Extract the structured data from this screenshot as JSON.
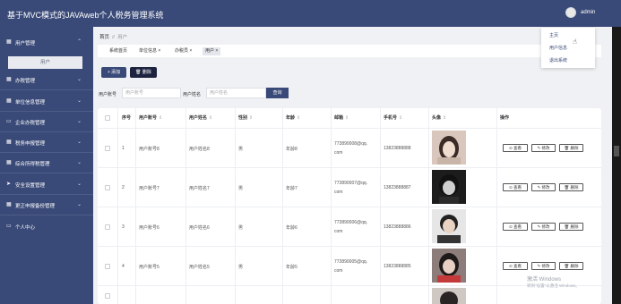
{
  "header": {
    "title": "基于MVC模式的JAVAweb个人税务管理系统",
    "user": "admin"
  },
  "user_menu": {
    "items": [
      "主页",
      "用户信息",
      "退出系统"
    ]
  },
  "sidebar": {
    "items": [
      {
        "label": "用户管理",
        "icon": "grid-icon",
        "expanded": true
      },
      {
        "label": "办税管理",
        "icon": "grid-icon"
      },
      {
        "label": "单位信息管理",
        "icon": "grid-icon"
      },
      {
        "label": "企业办税管理",
        "icon": "card-icon"
      },
      {
        "label": "税务申报管理",
        "icon": "grid-icon"
      },
      {
        "label": "综合所得税管理",
        "icon": "grid-icon"
      },
      {
        "label": "安全设置管理",
        "icon": "paper-plane-icon"
      },
      {
        "label": "更正申报备份管理",
        "icon": "grid-icon"
      },
      {
        "label": "个人中心",
        "icon": "card-icon"
      }
    ],
    "submenu": {
      "label": "用户"
    }
  },
  "breadcrumb": {
    "home": "首页",
    "separator": "//",
    "current": "用户"
  },
  "tags": [
    {
      "label": "系统首页",
      "closable": false
    },
    {
      "label": "单位信息",
      "closable": true
    },
    {
      "label": "办税员",
      "closable": true
    },
    {
      "label": "用户",
      "closable": true,
      "active": true
    }
  ],
  "toolbar": {
    "add_label": "添加",
    "delete_label": "删除"
  },
  "search": {
    "account_label": "用户账号",
    "account_placeholder": "用户账号",
    "name_label": "用户姓名",
    "name_placeholder": "用户姓名",
    "button_label": "查询"
  },
  "table": {
    "columns": [
      "序号",
      "用户账号",
      "用户姓名",
      "性别",
      "年龄",
      "邮箱",
      "手机号",
      "头像",
      "操作"
    ],
    "rows": [
      {
        "index": "1",
        "account": "用户账号8",
        "name": "用户姓名8",
        "gender": "男",
        "age": "年龄8",
        "email1": "773890008@qq.",
        "email2": "com",
        "phone": "13823888888"
      },
      {
        "index": "2",
        "account": "用户账号7",
        "name": "用户姓名7",
        "gender": "男",
        "age": "年龄7",
        "email1": "773890007@qq.",
        "email2": "com",
        "phone": "13823888887"
      },
      {
        "index": "3",
        "account": "用户账号6",
        "name": "用户姓名6",
        "gender": "男",
        "age": "年龄6",
        "email1": "773890006@qq.",
        "email2": "com",
        "phone": "13823888886"
      },
      {
        "index": "4",
        "account": "用户账号5",
        "name": "用户姓名5",
        "gender": "男",
        "age": "年龄5",
        "email1": "773890005@qq.",
        "email2": "com",
        "phone": "13823888885"
      }
    ],
    "actions": {
      "view": "查看",
      "edit": "修改",
      "delete": "删除"
    }
  },
  "watermark": {
    "line1": "激活 Windows",
    "line2": "转到\"设置\"以激活 Windows。"
  },
  "colors": {
    "primary": "#3a4a78",
    "dark_button": "#1e2340",
    "background": "#f0f1f4"
  }
}
